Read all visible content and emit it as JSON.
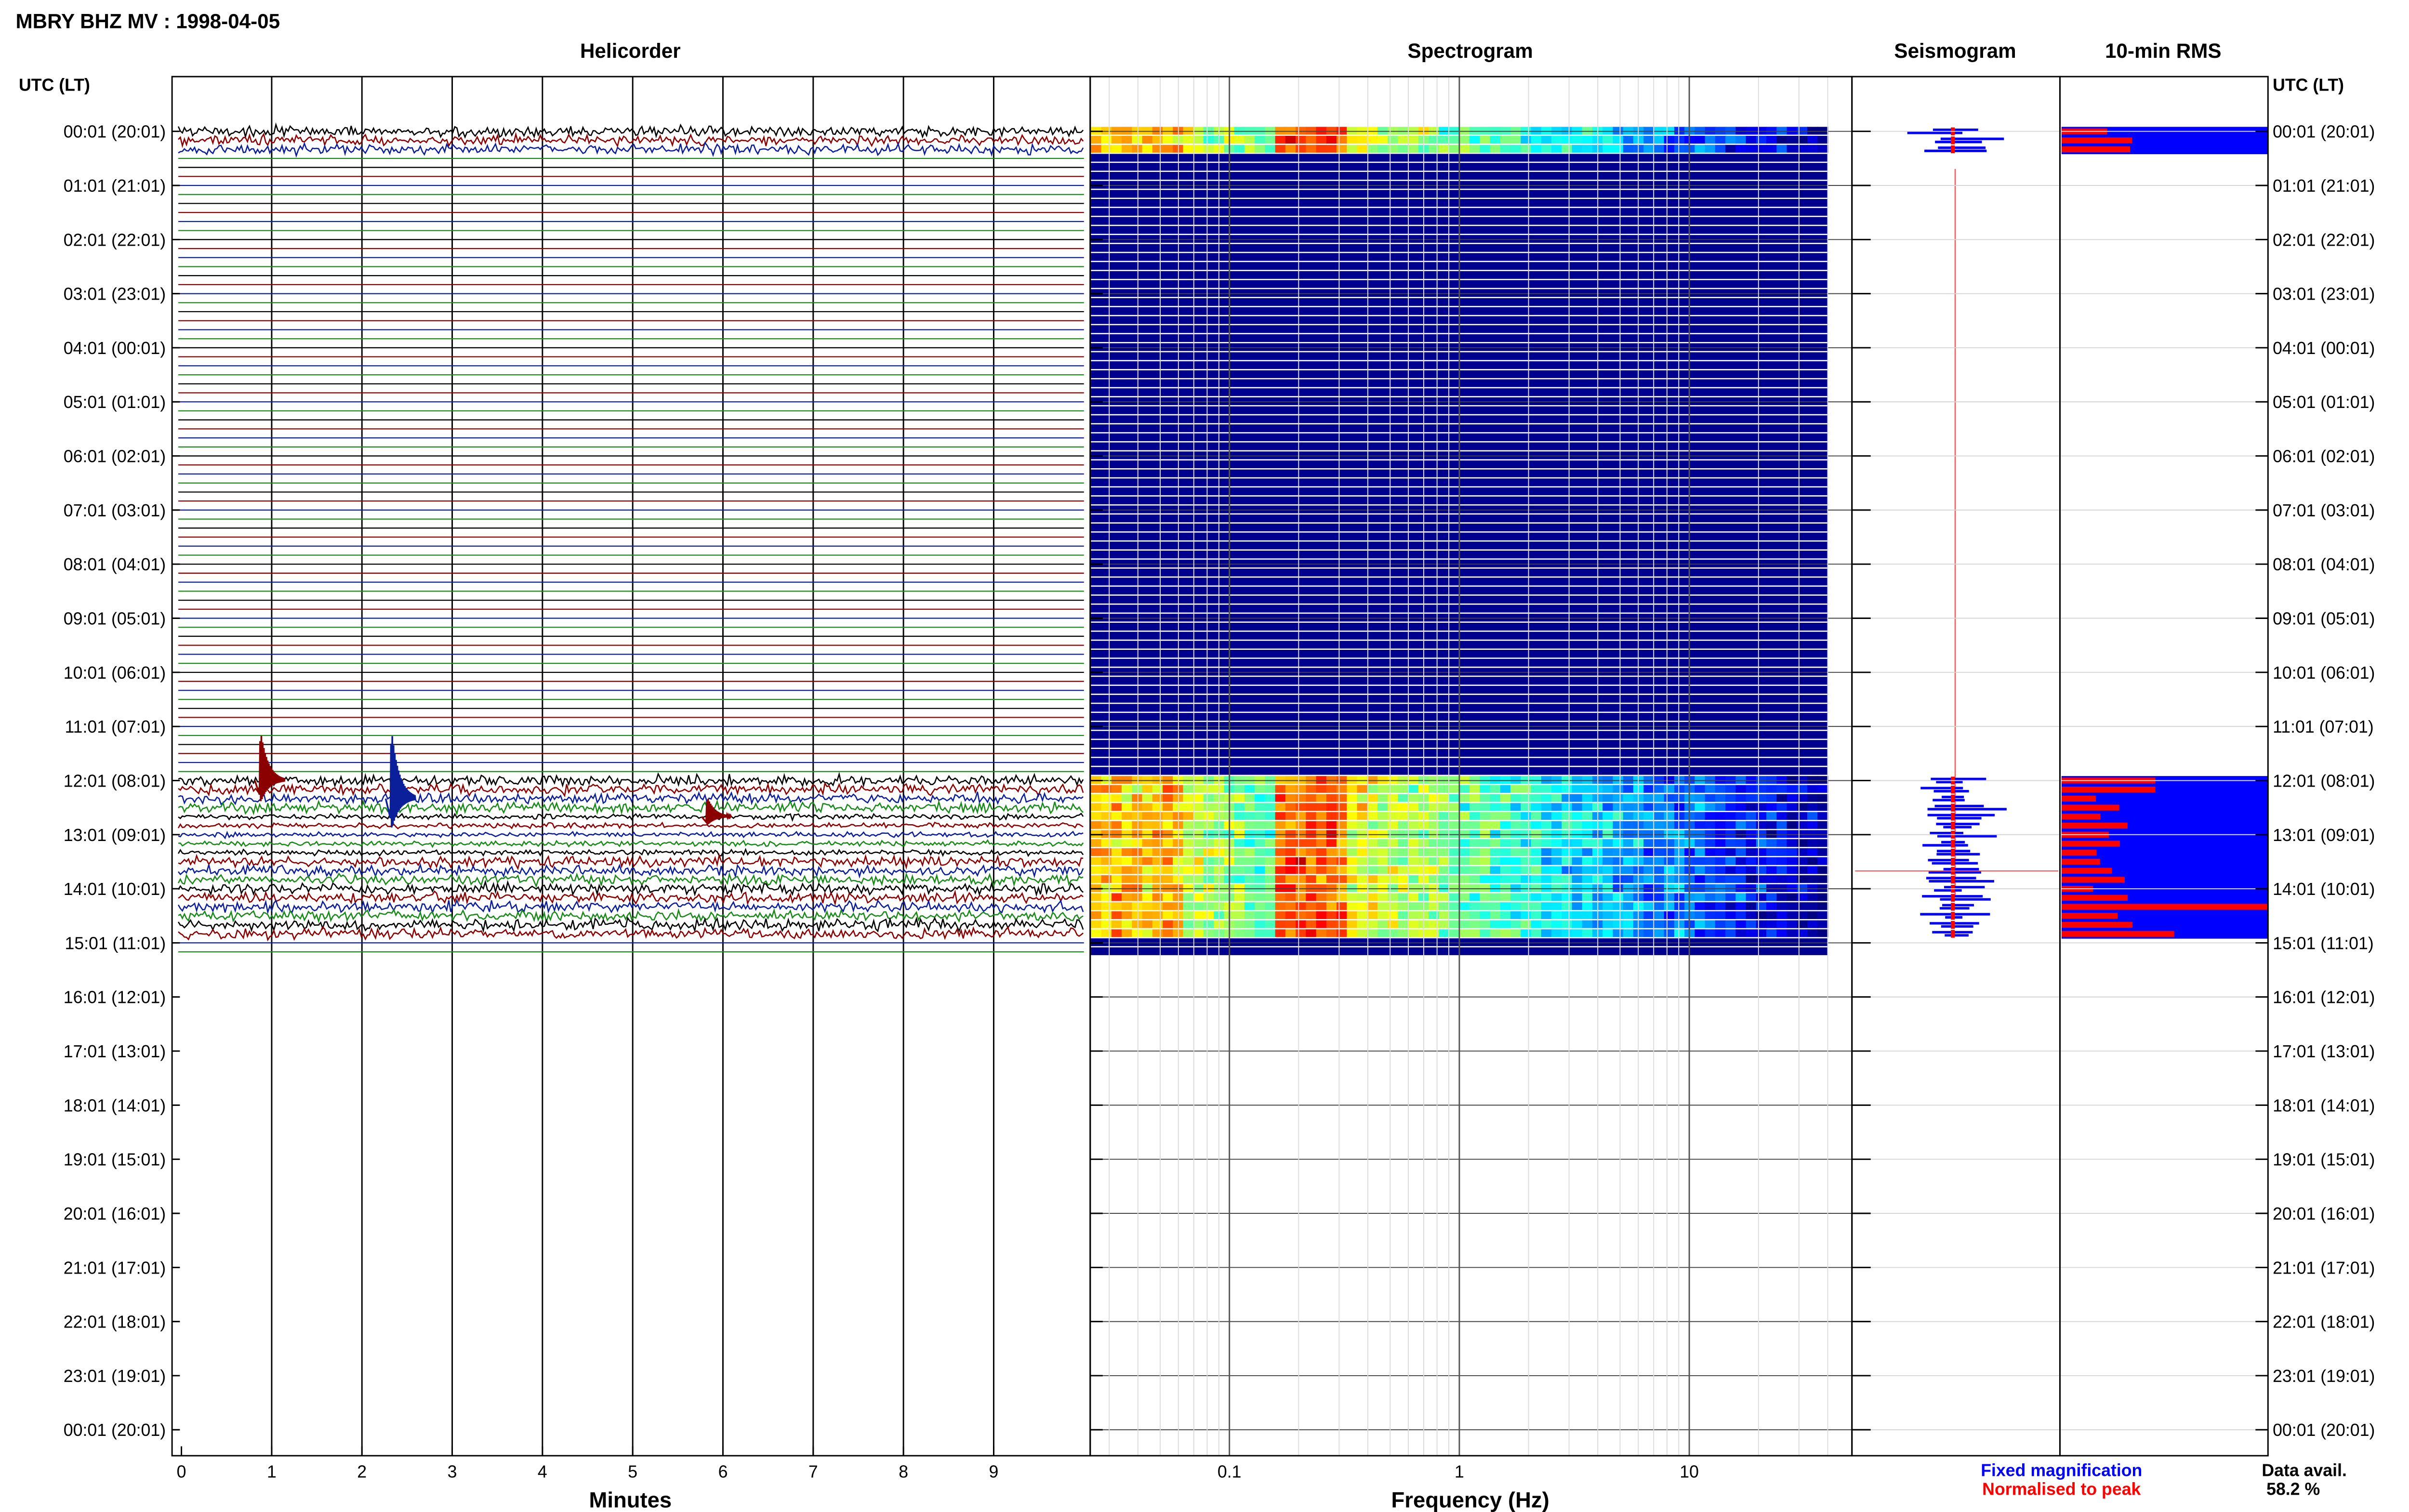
{
  "title": "MBRY BHZ MV : 1998-04-05",
  "panels": {
    "helicorder": "Helicorder",
    "spectrogram": "Spectrogram",
    "seismogram": "Seismogram",
    "rms": "10-min RMS"
  },
  "time_axis_title": "UTC (LT)",
  "row_labels": [
    "00:01 (20:01)",
    "01:01 (21:01)",
    "02:01 (22:01)",
    "03:01 (23:01)",
    "04:01 (00:01)",
    "05:01 (01:01)",
    "06:01 (02:01)",
    "07:01 (03:01)",
    "08:01 (04:01)",
    "09:01 (05:01)",
    "10:01 (06:01)",
    "11:01 (07:01)",
    "12:01 (08:01)",
    "13:01 (09:01)",
    "14:01 (10:01)",
    "15:01 (11:01)",
    "16:01 (12:01)",
    "17:01 (13:01)",
    "18:01 (14:01)",
    "19:01 (15:01)",
    "20:01 (16:01)",
    "21:01 (17:01)",
    "22:01 (18:01)",
    "23:01 (19:01)",
    "00:01 (20:01)"
  ],
  "minutes_ticks": [
    "0",
    "1",
    "2",
    "3",
    "4",
    "5",
    "6",
    "7",
    "8",
    "9"
  ],
  "minutes_label": "Minutes",
  "freq_ticks": [
    "0.1",
    "1",
    "10"
  ],
  "freq_label": "Frequency (Hz)",
  "legend": {
    "fixed": "Fixed magnification",
    "normalised": "Normalised to peak"
  },
  "data_avail_label": "Data avail.",
  "data_avail_value": "58.2 %",
  "colors": {
    "trace_cycle": [
      "#000000",
      "#8b0000",
      "#0b1f9a",
      "#1a8a1a"
    ],
    "fixed": "#0000ff",
    "normalised": "#ff0000",
    "spectrogram_empty": "#00008f"
  },
  "chart_data": {
    "type": "helicorder",
    "station": "MBRY BHZ MV",
    "date": "1998-04-05",
    "minutes_range": [
      0,
      10
    ],
    "frequency_range_hz": [
      0.025,
      40
    ],
    "frequency_scale": "log",
    "data_availability_percent": 58.2,
    "events": [
      {
        "time_utc": "12:00",
        "minute": 0.9,
        "color": "dark red",
        "amplitude_rows": 6.3
      },
      {
        "time_utc": "12:20",
        "minute": 2.35,
        "color": "blue",
        "amplitude_rows": 8.8
      },
      {
        "time_utc": "12:40",
        "minute": 5.85,
        "color": "dark red",
        "amplitude_rows": 2.5
      }
    ]
  }
}
